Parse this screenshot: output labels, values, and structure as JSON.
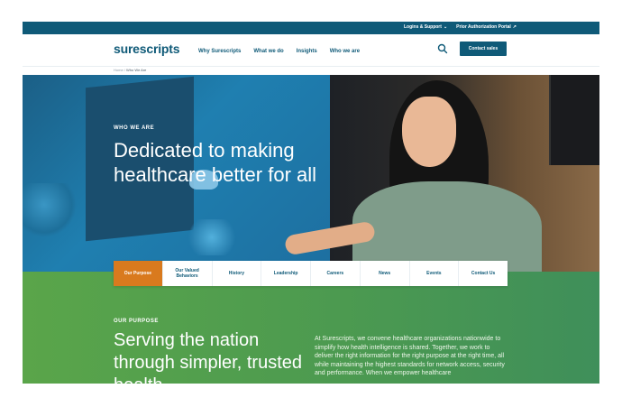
{
  "utility_bar": {
    "logins_label": "Logins & Support",
    "portal_label": "Prior Authorization Portal"
  },
  "header": {
    "logo_text": "surescripts",
    "nav": [
      "Why Surescripts",
      "What we do",
      "Insights",
      "Who we are"
    ],
    "cta_label": "Contact sales"
  },
  "breadcrumb": {
    "home": "Home",
    "current": "Who We Are"
  },
  "hero": {
    "eyebrow": "WHO WE ARE",
    "title": "Dedicated to making healthcare better for all"
  },
  "tabs": [
    {
      "label": "Our Purpose",
      "active": true
    },
    {
      "label": "Our Valued Behaviors",
      "active": false
    },
    {
      "label": "History",
      "active": false
    },
    {
      "label": "Leadership",
      "active": false
    },
    {
      "label": "Careers",
      "active": false
    },
    {
      "label": "News",
      "active": false
    },
    {
      "label": "Events",
      "active": false
    },
    {
      "label": "Contact Us",
      "active": false
    }
  ],
  "purpose": {
    "eyebrow": "OUR PURPOSE",
    "title": "Serving the nation through simpler, trusted health",
    "body": "At Surescripts, we convene healthcare organizations nationwide to simplify how health intelligence is shared. Together, we work to deliver the right information for the right purpose at the right time, all while maintaining the highest standards for network access, security and performance. When we empower healthcare"
  },
  "colors": {
    "brand_navy": "#0f5a78",
    "accent_orange": "#d97a1e",
    "purpose_green": "#4c9a50"
  }
}
